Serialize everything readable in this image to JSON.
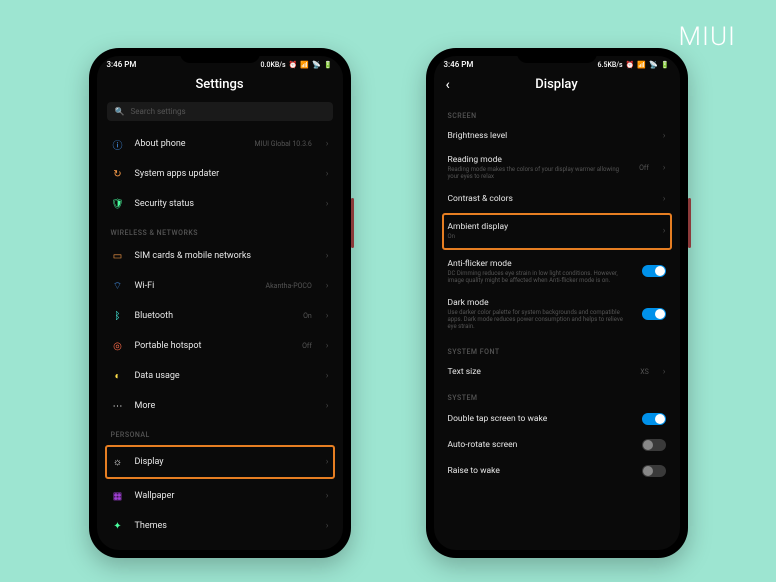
{
  "brand": "MIUI",
  "statusbar": {
    "time": "3:46 PM",
    "net_l": "0.0KB/s",
    "net_r": "6.5KB/s"
  },
  "left": {
    "title": "Settings",
    "search_placeholder": "Search settings",
    "items": {
      "about": {
        "label": "About phone",
        "value": "MIUI Global 10.3.6"
      },
      "updater": {
        "label": "System apps updater"
      },
      "security": {
        "label": "Security status"
      },
      "section_wireless": "WIRELESS & NETWORKS",
      "sim": {
        "label": "SIM cards & mobile networks"
      },
      "wifi": {
        "label": "Wi-Fi",
        "value": "Akantha-POCO"
      },
      "bt": {
        "label": "Bluetooth",
        "value": "On"
      },
      "hotspot": {
        "label": "Portable hotspot",
        "value": "Off"
      },
      "data": {
        "label": "Data usage"
      },
      "more": {
        "label": "More"
      },
      "section_personal": "PERSONAL",
      "display": {
        "label": "Display"
      },
      "wallpaper": {
        "label": "Wallpaper"
      },
      "themes": {
        "label": "Themes"
      }
    }
  },
  "right": {
    "title": "Display",
    "sections": {
      "screen": "SCREEN",
      "brightness": {
        "label": "Brightness level"
      },
      "reading": {
        "label": "Reading mode",
        "sub": "Reading mode makes the colors of your display warmer allowing your eyes to relax",
        "value": "Off"
      },
      "contrast": {
        "label": "Contrast & colors"
      },
      "ambient": {
        "label": "Ambient display",
        "sub": "On"
      },
      "antiflicker": {
        "label": "Anti-flicker mode",
        "sub": "DC Dimming reduces eye strain in low light conditions. However, image quality might be affected when Anti-flicker mode is on."
      },
      "dark": {
        "label": "Dark mode",
        "sub": "Use darker color palette for system backgrounds and compatible apps. Dark mode reduces power consumption and helps to relieve eye strain."
      },
      "font_section": "SYSTEM FONT",
      "textsize": {
        "label": "Text size",
        "value": "XS"
      },
      "system_section": "SYSTEM",
      "doubletap": {
        "label": "Double tap screen to wake"
      },
      "autorotate": {
        "label": "Auto-rotate screen"
      },
      "raise": {
        "label": "Raise to wake"
      }
    }
  }
}
